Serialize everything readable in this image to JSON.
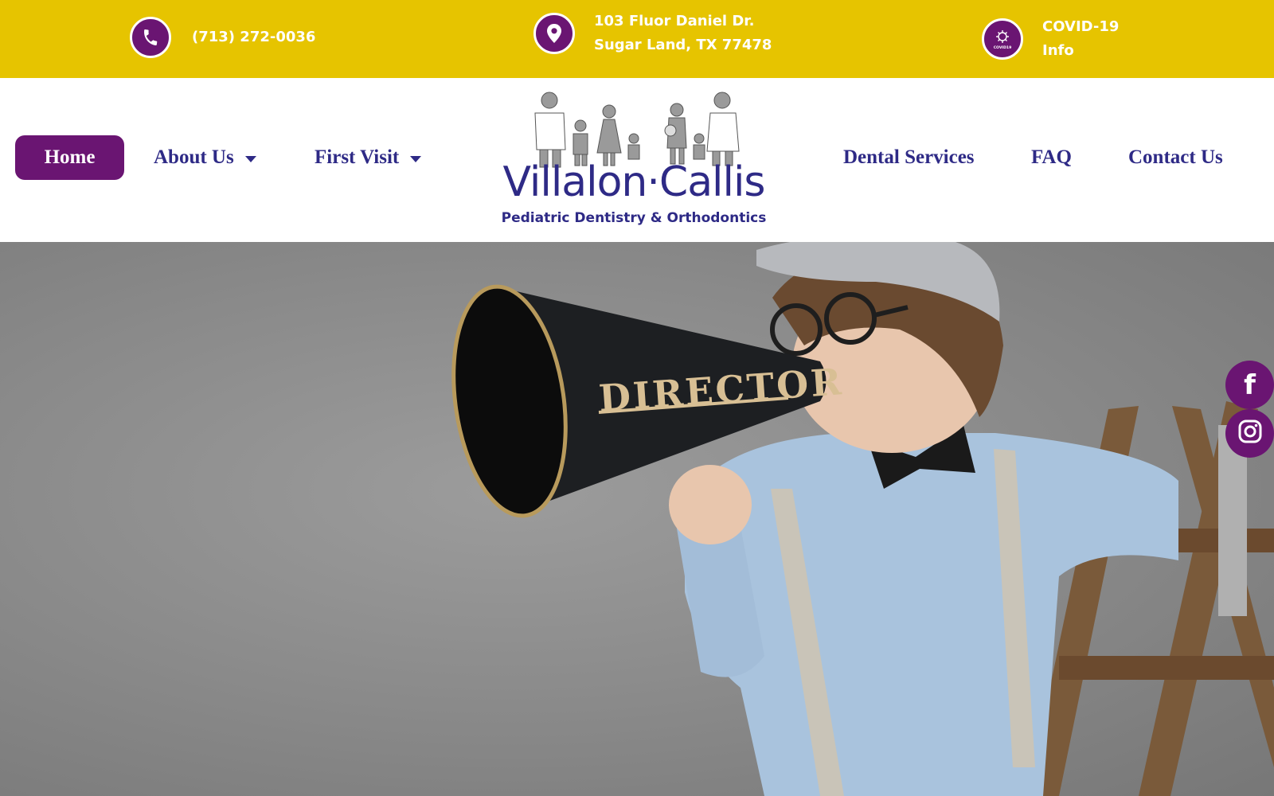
{
  "topbar": {
    "background": "#e6c400",
    "accent": "#6a1572",
    "phone": {
      "icon": "phone-icon",
      "text": "(713) 272-0036"
    },
    "address": {
      "icon": "map-pin-icon",
      "line1": "103 Fluor Daniel Dr.",
      "line2": "Sugar Land, TX 77478"
    },
    "covid": {
      "icon": "covid-icon",
      "icon_label": "COVID19",
      "line1": "COVID-19",
      "line2": "Info"
    }
  },
  "nav": {
    "left": [
      {
        "label": "Home",
        "active": true
      },
      {
        "label": "About Us",
        "dropdown": true
      },
      {
        "label": "First Visit",
        "dropdown": true
      }
    ],
    "right": [
      {
        "label": "Dental Services"
      },
      {
        "label": "FAQ"
      },
      {
        "label": "Contact Us"
      }
    ],
    "text_color": "#2e2a86",
    "active_background": "#6a1572"
  },
  "logo": {
    "wordmark": "Villalon·Callis",
    "tagline": "Pediatric Dentistry & Orthodontics"
  },
  "hero": {
    "megaphone_text": "DIRECTOR"
  },
  "social": [
    {
      "name": "facebook",
      "icon": "facebook-icon",
      "glyph": "f"
    },
    {
      "name": "instagram",
      "icon": "instagram-icon"
    }
  ]
}
